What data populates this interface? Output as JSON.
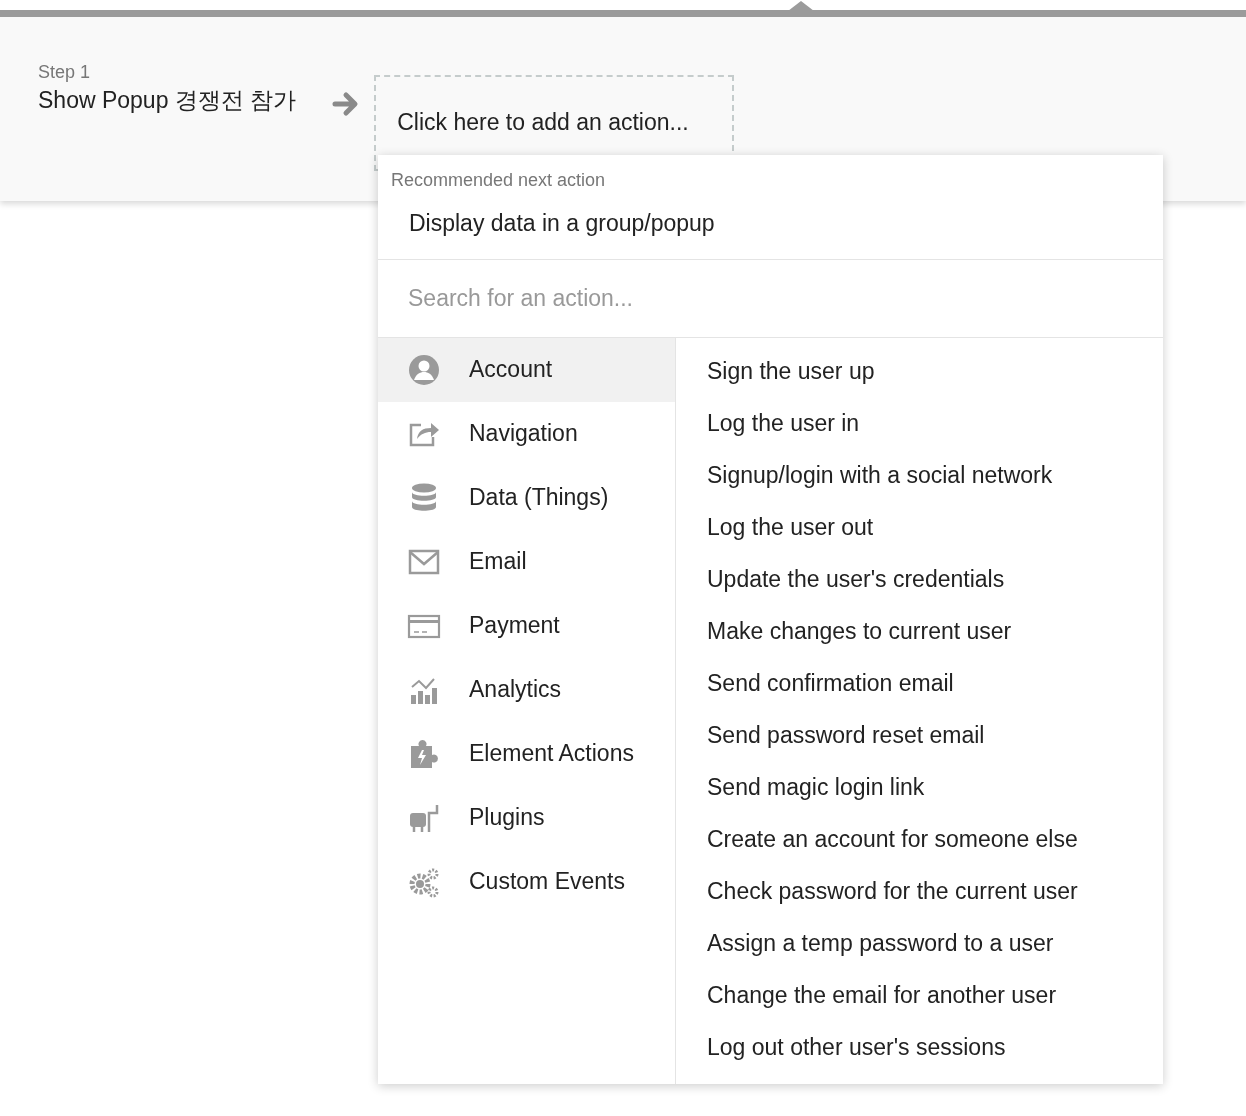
{
  "step": {
    "label": "Step 1",
    "title": "Show Popup 경쟁전 참가"
  },
  "add_action": "Click here to add an action...",
  "recommended": {
    "heading": "Recommended next action",
    "action": "Display data in a group/popup"
  },
  "search": {
    "placeholder": "Search for an action..."
  },
  "categories": [
    {
      "kind": "account",
      "label": "Account",
      "selected": true
    },
    {
      "kind": "navigation",
      "label": "Navigation",
      "selected": false
    },
    {
      "kind": "data",
      "label": "Data (Things)",
      "selected": false
    },
    {
      "kind": "email",
      "label": "Email",
      "selected": false
    },
    {
      "kind": "payment",
      "label": "Payment",
      "selected": false
    },
    {
      "kind": "analytics",
      "label": "Analytics",
      "selected": false
    },
    {
      "kind": "element",
      "label": "Element Actions",
      "selected": false
    },
    {
      "kind": "plugins",
      "label": "Plugins",
      "selected": false
    },
    {
      "kind": "events",
      "label": "Custom Events",
      "selected": false
    }
  ],
  "actions": [
    "Sign the user up",
    "Log the user in",
    "Signup/login with a social network",
    "Log the user out",
    "Update the user's credentials",
    "Make changes to current user",
    "Send confirmation email",
    "Send password reset email",
    "Send magic login link",
    "Create an account for someone else",
    "Check password for the current user",
    "Assign a temp password to a user",
    "Change the email for another user",
    "Log out other user's sessions"
  ]
}
